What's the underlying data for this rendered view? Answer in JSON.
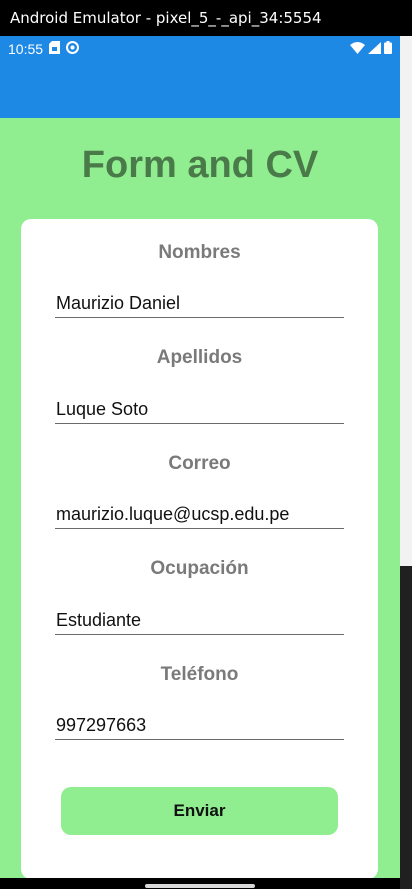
{
  "window": {
    "title": "Android Emulator - pixel_5_-_api_34:5554"
  },
  "status_bar": {
    "time": "10:55",
    "left_icons": [
      "sim-card-icon",
      "sync-icon"
    ],
    "right_icons": [
      "wifi-icon",
      "signal-icon",
      "battery-icon"
    ],
    "color": "#1e88e5"
  },
  "colors": {
    "app_bar": "#1e88e5",
    "background": "#90ee90",
    "title": "#4a7a4a",
    "button": "#90ee90"
  },
  "page": {
    "title": "Form and CV"
  },
  "form": {
    "fields": [
      {
        "label": "Nombres",
        "value": "Maurizio Daniel"
      },
      {
        "label": "Apellidos",
        "value": "Luque Soto"
      },
      {
        "label": "Correo",
        "value": "maurizio.luque@ucsp.edu.pe"
      },
      {
        "label": "Ocupación",
        "value": "Estudiante"
      },
      {
        "label": "Teléfono",
        "value": "997297663"
      }
    ],
    "submit_label": "Enviar"
  }
}
